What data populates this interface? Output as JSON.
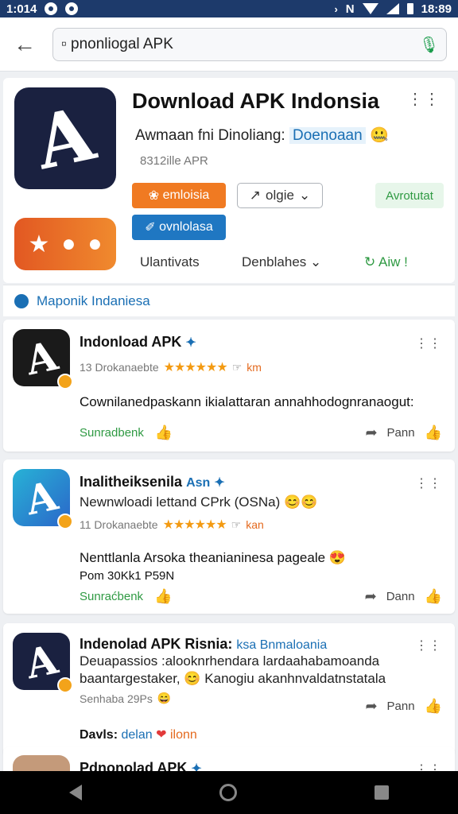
{
  "status_bar": {
    "time_left": "1:014",
    "time_right": "18:89",
    "notif_glyph": "N"
  },
  "toolbar": {
    "search_value": "▫ pnonliogal APK"
  },
  "hero": {
    "title": "Download APK Indonsia",
    "subtitle": "Awmaan fni Dinoliang:",
    "subtitle_accent": "Doenoaan",
    "meta": "8312ille APR",
    "btn_orange": "emloisia",
    "btn_outline": "olgie",
    "btn_green": "Avrotutat",
    "btn_blue": "ovnlolasa",
    "tab_1": "Ulantivats",
    "tab_2": "Denblahes",
    "tab_3": "Aiw !"
  },
  "section": {
    "label": "Maponik Indaniesa"
  },
  "cards": [
    {
      "title": "Indonload APK",
      "meta": "13 Drokanaebte",
      "meta_extra": "km",
      "desc": "Cownilanedpaskann ikialattaran annahhodognranaogut:",
      "action_left": "Sunradbenk",
      "action_right": "Pann"
    },
    {
      "title": "Inalitheiksenila",
      "title_accent": "Asn",
      "line": "Newnwloadi lettand CPrk (OSNa)",
      "meta": "11 Drokanaebte",
      "meta_extra": "kan",
      "desc": "Nenttlanla Arsoka theanianinesa pageale",
      "desc2": "Pom 30Kk1 P59N",
      "action_left": "Sunraćbenk",
      "action_right": "Dann"
    },
    {
      "title": "Indenolad APK Risnia:",
      "title_accent": "ksa Bnmaloania",
      "line": "Deuapassios :alooknrhendara lardaahabamoanda",
      "line2": "baantargestaker,",
      "line2_tail": "Kanogiu akanhnvaldatnstatala",
      "meta": "Senhaba 29Ps",
      "tag_label": "Davls:",
      "tag_accent": "delan",
      "tag_tail": "ilonn",
      "action_right": "Pann"
    },
    {
      "title": "Pdnonolad APK"
    }
  ],
  "colors": {
    "accent_blue": "#1a6fb4",
    "accent_orange": "#f07a22",
    "accent_green": "#2f9a43",
    "status_bar": "#1d3a6b"
  }
}
